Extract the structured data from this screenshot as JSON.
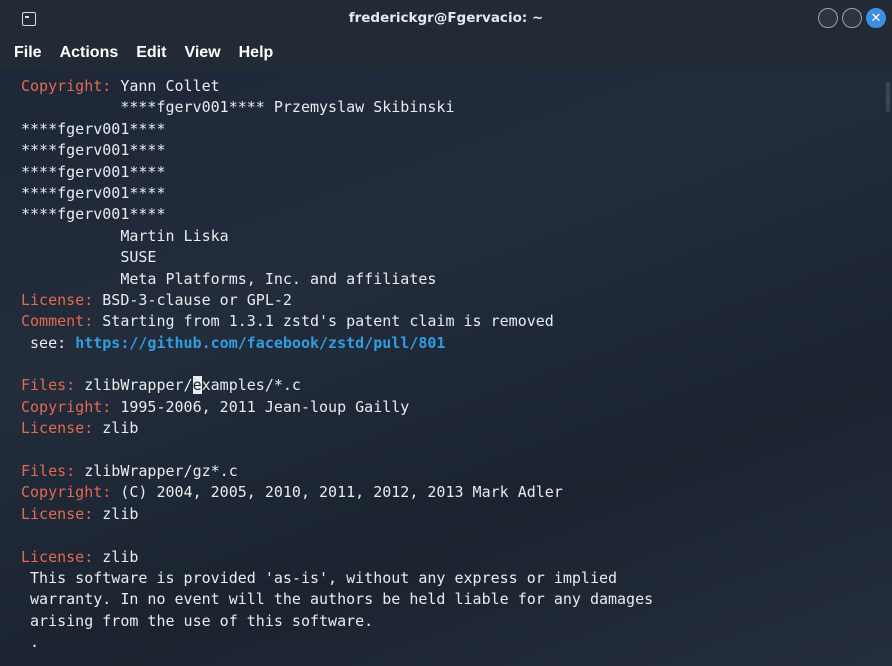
{
  "window": {
    "title": "frederickgr@Fgervacio: ~",
    "close_glyph": "✕"
  },
  "menu": [
    "File",
    "Actions",
    "Edit",
    "View",
    "Help"
  ],
  "terminal": {
    "lines": [
      {
        "key": "Copyright:",
        "text": " Yann Collet"
      },
      {
        "text": "           ****fgerv001**** Przemyslaw Skibinski"
      },
      {
        "text": "****fgerv001****"
      },
      {
        "text": "****fgerv001****"
      },
      {
        "text": "****fgerv001****"
      },
      {
        "text": "****fgerv001****"
      },
      {
        "text": "****fgerv001****"
      },
      {
        "text": "           Martin Liska"
      },
      {
        "text": "           SUSE"
      },
      {
        "text": "           Meta Platforms, Inc. and affiliates"
      },
      {
        "key": "License:",
        "text": " BSD-3-clause or GPL-2"
      },
      {
        "key": "Comment:",
        "text": " Starting from 1.3.1 zstd's patent claim is removed"
      },
      {
        "text": " see: ",
        "link": "https://github.com/facebook/zstd/pull/801"
      },
      {
        "text": ""
      },
      {
        "key": "Files:",
        "text": " zlibWrapper/",
        "cursor": "e",
        "after": "xamples/*.c"
      },
      {
        "key": "Copyright:",
        "text": " 1995-2006, 2011 Jean-loup Gailly"
      },
      {
        "key": "License:",
        "text": " zlib"
      },
      {
        "text": ""
      },
      {
        "key": "Files:",
        "text": " zlibWrapper/gz*.c"
      },
      {
        "key": "Copyright:",
        "text": " (C) 2004, 2005, 2010, 2011, 2012, 2013 Mark Adler"
      },
      {
        "key": "License:",
        "text": " zlib"
      },
      {
        "text": ""
      },
      {
        "key": "License:",
        "text": " zlib"
      },
      {
        "text": " This software is provided 'as-is', without any express or implied"
      },
      {
        "text": " warranty. In no event will the authors be held liable for any damages"
      },
      {
        "text": " arising from the use of this software."
      },
      {
        "text": " ."
      }
    ]
  }
}
